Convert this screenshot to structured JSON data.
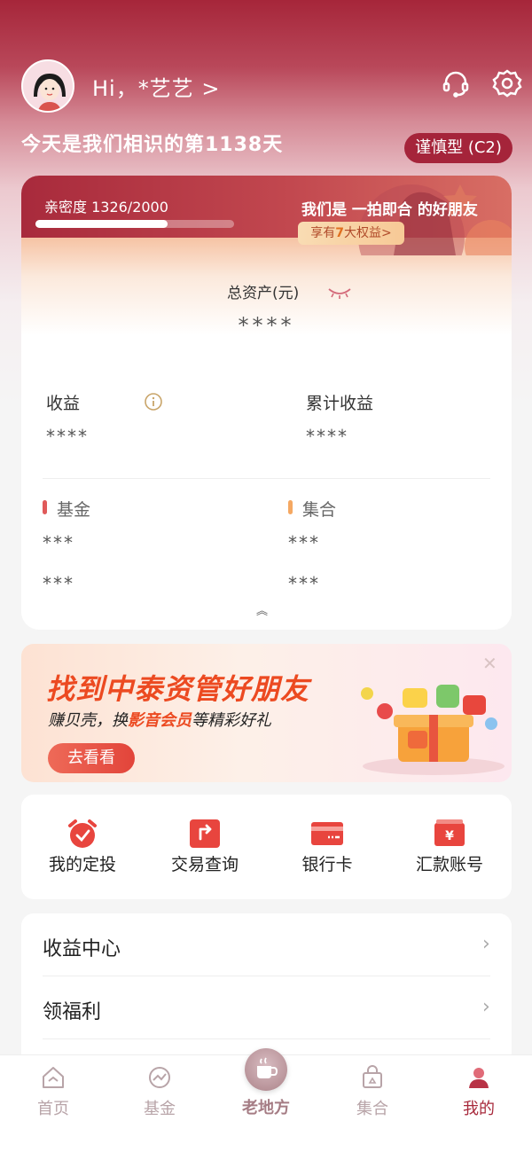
{
  "header": {
    "greeting": "Hi，*艺艺 >",
    "days_text": "今天是我们相识的第1138天",
    "risk_level": "谨慎型 (C2)"
  },
  "card": {
    "intimacy_label": "亲密度 1326/2000",
    "intimacy_progress": 0.663,
    "friend_text": "我们是 一拍即合 的好朋友",
    "benefit_prefix": "享有",
    "benefit_num": "7",
    "benefit_suffix": "大权益>",
    "total_assets_label": "总资产(元)",
    "total_assets_value": "****",
    "income_label": "收益",
    "income_value": "****",
    "cumulative_label": "累计收益",
    "cumulative_value": "****",
    "fund_label": "基金",
    "fund_value1": "***",
    "fund_value2": "***",
    "collection_label": "集合",
    "collection_value1": "***",
    "collection_value2": "***",
    "collapse_glyph": "︽"
  },
  "promo": {
    "title": "找到中泰资管好朋友",
    "sub_prefix": "赚贝壳，换",
    "sub_highlight": "影音会员",
    "sub_suffix": "等精彩好礼",
    "button": "去看看",
    "close": "✕"
  },
  "quick": [
    {
      "label": "我的定投",
      "icon": "alarm-clock-icon"
    },
    {
      "label": "交易查询",
      "icon": "exchange-arrow-icon"
    },
    {
      "label": "银行卡",
      "icon": "bank-card-icon"
    },
    {
      "label": "汇款账号",
      "icon": "yen-wallet-icon"
    }
  ],
  "list": [
    {
      "label": "收益中心",
      "chevron": "›"
    },
    {
      "label": "领福利",
      "chevron": "›"
    }
  ],
  "tabs": [
    {
      "label": "首页",
      "icon": "home-icon"
    },
    {
      "label": "基金",
      "icon": "fund-chart-icon"
    },
    {
      "label": "老地方",
      "icon": "coffee-cup-icon"
    },
    {
      "label": "集合",
      "icon": "shopping-bag-icon"
    },
    {
      "label": "我的",
      "icon": "user-icon"
    }
  ],
  "colors": {
    "brand": "#a82a3c",
    "accent_orange": "#ec4a21"
  }
}
